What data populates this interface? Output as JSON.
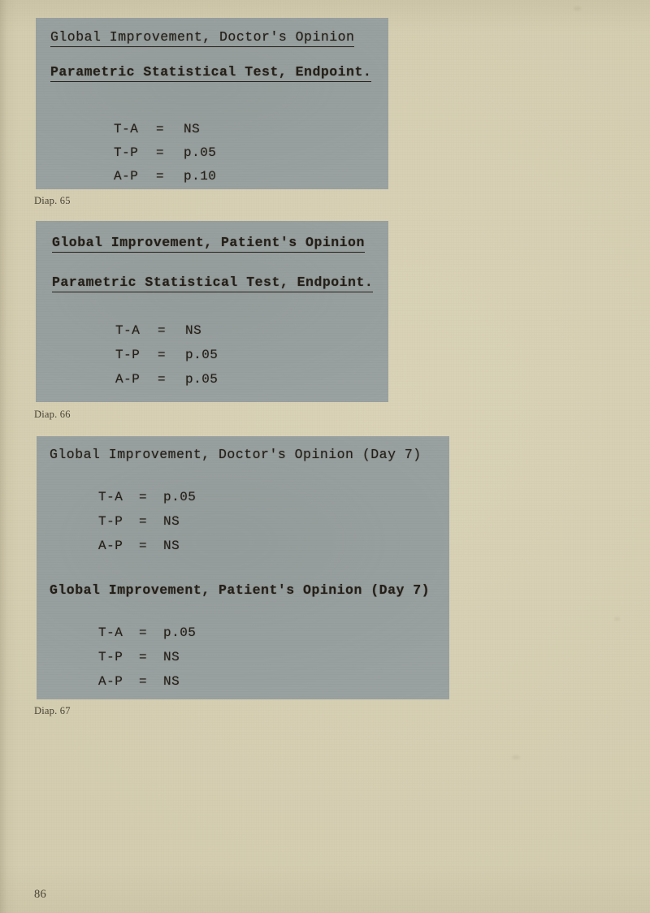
{
  "page": {
    "folio": "86",
    "background_color": "#d4cdb0",
    "slide_color": "#9ba3a2",
    "ink_color": "#241f18"
  },
  "slides": [
    {
      "id": "65",
      "caption": "Diap. 65",
      "headings": [
        "Global Improvement, Doctor's Opinion",
        "Parametric Statistical Test, Endpoint."
      ],
      "rows": [
        {
          "label": "T-A",
          "eq": "=",
          "value": "NS"
        },
        {
          "label": "T-P",
          "eq": "=",
          "value": "p.05"
        },
        {
          "label": "A-P",
          "eq": "=",
          "value": "p.10"
        }
      ]
    },
    {
      "id": "66",
      "caption": "Diap. 66",
      "headings": [
        "Global Improvement, Patient's Opinion",
        "Parametric Statistical Test, Endpoint."
      ],
      "rows": [
        {
          "label": "T-A",
          "eq": "=",
          "value": "NS"
        },
        {
          "label": "T-P",
          "eq": "=",
          "value": "p.05"
        },
        {
          "label": "A-P",
          "eq": "=",
          "value": "p.05"
        }
      ]
    },
    {
      "id": "67",
      "caption": "Diap. 67",
      "headings": [
        "Global Improvement, Doctor's Opinion (Day 7)",
        "Global Improvement, Patient's Opinion (Day 7)"
      ],
      "block1_rows": [
        {
          "label": "T-A",
          "eq": "=",
          "value": "p.05"
        },
        {
          "label": "T-P",
          "eq": "=",
          "value": "NS"
        },
        {
          "label": "A-P",
          "eq": "=",
          "value": "NS"
        }
      ],
      "block2_rows": [
        {
          "label": "T-A",
          "eq": "=",
          "value": "p.05"
        },
        {
          "label": "T-P",
          "eq": "=",
          "value": "NS"
        },
        {
          "label": "A-P",
          "eq": "=",
          "value": "NS"
        }
      ]
    }
  ]
}
